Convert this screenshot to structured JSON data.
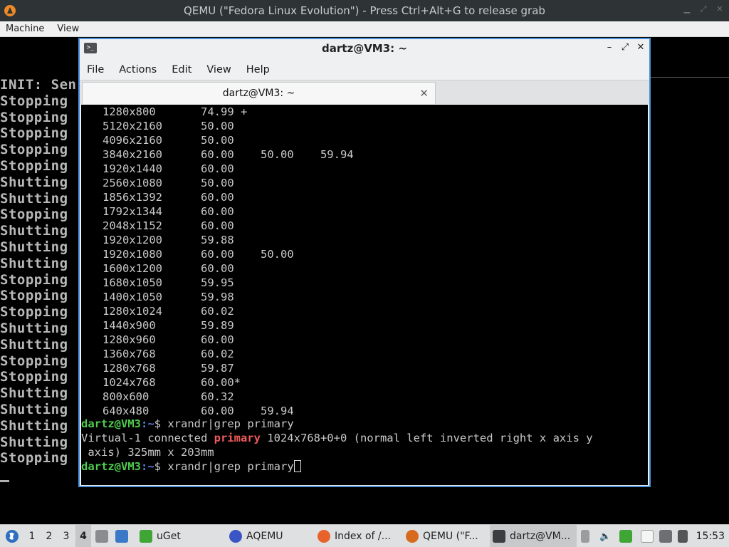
{
  "qemu": {
    "title": "QEMU (\"Fedora Linux Evolution\") - Press Ctrl+Alt+G to release grab",
    "menu": [
      "Machine",
      "View"
    ]
  },
  "console": {
    "lines": [
      "INIT: Sen",
      "Stopping",
      "Stopping",
      "Stopping",
      "Stopping",
      "Stopping",
      "Shutting",
      "Shutting",
      "Stopping",
      "Shutting",
      "Shutting",
      "Shutting",
      "Stopping",
      "Stopping",
      "Stopping",
      "Shutting",
      "Shutting",
      "Stopping",
      "Stopping",
      "Shutting",
      "Shutting",
      "Shutting",
      "Shutting",
      "Stopping"
    ]
  },
  "terminal": {
    "title": "dartz@VM3: ~",
    "menu": [
      "File",
      "Actions",
      "Edit",
      "View",
      "Help"
    ],
    "tab_label": "dartz@VM3: ~",
    "modes": [
      {
        "res": "1280x800",
        "rates": "74.99 +"
      },
      {
        "res": "5120x2160",
        "rates": "50.00"
      },
      {
        "res": "4096x2160",
        "rates": "50.00"
      },
      {
        "res": "3840x2160",
        "rates": "60.00    50.00    59.94"
      },
      {
        "res": "1920x1440",
        "rates": "60.00"
      },
      {
        "res": "2560x1080",
        "rates": "50.00"
      },
      {
        "res": "1856x1392",
        "rates": "60.00"
      },
      {
        "res": "1792x1344",
        "rates": "60.00"
      },
      {
        "res": "2048x1152",
        "rates": "60.00"
      },
      {
        "res": "1920x1200",
        "rates": "59.88"
      },
      {
        "res": "1920x1080",
        "rates": "60.00    50.00"
      },
      {
        "res": "1600x1200",
        "rates": "60.00"
      },
      {
        "res": "1680x1050",
        "rates": "59.95"
      },
      {
        "res": "1400x1050",
        "rates": "59.98"
      },
      {
        "res": "1280x1024",
        "rates": "60.02"
      },
      {
        "res": "1440x900",
        "rates": "59.89"
      },
      {
        "res": "1280x960",
        "rates": "60.00"
      },
      {
        "res": "1360x768",
        "rates": "60.02"
      },
      {
        "res": "1280x768",
        "rates": "59.87"
      },
      {
        "res": "1024x768",
        "rates": "60.00*"
      },
      {
        "res": "800x600",
        "rates": "60.32"
      },
      {
        "res": "640x480",
        "rates": "60.00    59.94"
      }
    ],
    "prompt_user": "dartz@VM3",
    "prompt_path": ":~",
    "prompt_sym": "$ ",
    "command": "xrandr|grep primary",
    "output_pre": "Virtual-1 connected ",
    "output_keyword": "primary",
    "output_post": " 1024x768+0+0 (normal left inverted right x axis y",
    "output_line2": " axis) 325mm x 203mm"
  },
  "taskbar": {
    "workspaces": [
      "1",
      "2",
      "3",
      "4"
    ],
    "active_workspace": "4",
    "tasks": [
      {
        "label": "uGet",
        "icon": "uget-icon"
      },
      {
        "label": "AQEMU",
        "icon": "aqemu-icon"
      },
      {
        "label": "Index of /...",
        "icon": "firefox-icon"
      },
      {
        "label": "QEMU (\"F...",
        "icon": "qemu-icon"
      },
      {
        "label": "dartz@VM...",
        "icon": "terminal-icon"
      }
    ],
    "clock": "15:53"
  },
  "colors": {
    "prompt_user": "#4ecb4e",
    "prompt_path": "#5c7ce0",
    "highlight": "#ef5a5a",
    "window_border": "#4a90d9"
  }
}
